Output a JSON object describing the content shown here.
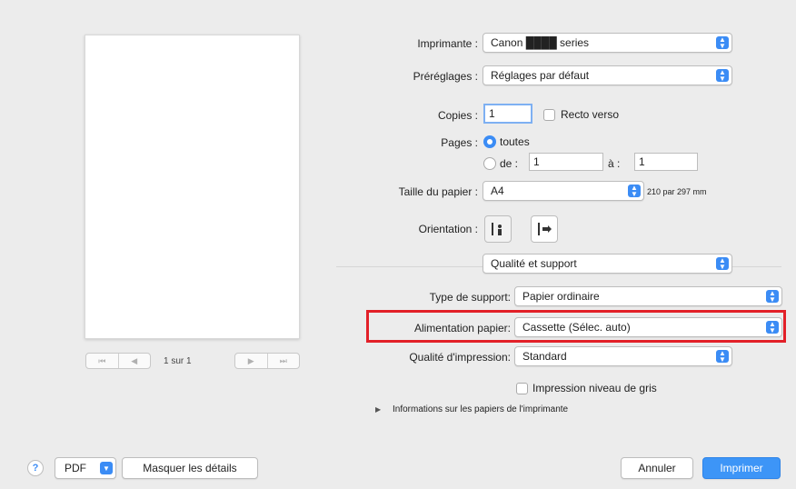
{
  "preview": {
    "nav_first": "⏮",
    "nav_prev": "◀",
    "nav_next": "▶",
    "nav_last": "⏭",
    "page_count": "1 sur 1"
  },
  "printer": {
    "label": "Imprimante :",
    "value": "Canon ████ series"
  },
  "presets": {
    "label": "Préréglages :",
    "value": "Réglages par défaut"
  },
  "copies": {
    "label": "Copies :",
    "value": "1",
    "duplex_label": "Recto verso"
  },
  "pages": {
    "label": "Pages :",
    "all_label": "toutes",
    "from_label": "de :",
    "from_value": "1",
    "to_label": "à :",
    "to_value": "1"
  },
  "paper_size": {
    "label": "Taille du papier :",
    "value": "A4",
    "dimensions": "210 par 297 mm"
  },
  "orientation": {
    "label": "Orientation :"
  },
  "section": {
    "value": "Qualité et support"
  },
  "media_type": {
    "label": "Type de support:",
    "value": "Papier ordinaire"
  },
  "paper_source": {
    "label": "Alimentation papier:",
    "value": "Cassette (Sélec. auto)"
  },
  "print_quality": {
    "label": "Qualité d'impression:",
    "value": "Standard"
  },
  "grayscale": {
    "label": "Impression niveau de gris"
  },
  "paper_info": {
    "label": "Informations sur les papiers de l'imprimante"
  },
  "footer": {
    "help": "?",
    "pdf_label": "PDF",
    "hide_details": "Masquer les détails",
    "cancel": "Annuler",
    "print": "Imprimer"
  },
  "colors": {
    "accent": "#3b8cf5",
    "highlight": "#e22028"
  }
}
